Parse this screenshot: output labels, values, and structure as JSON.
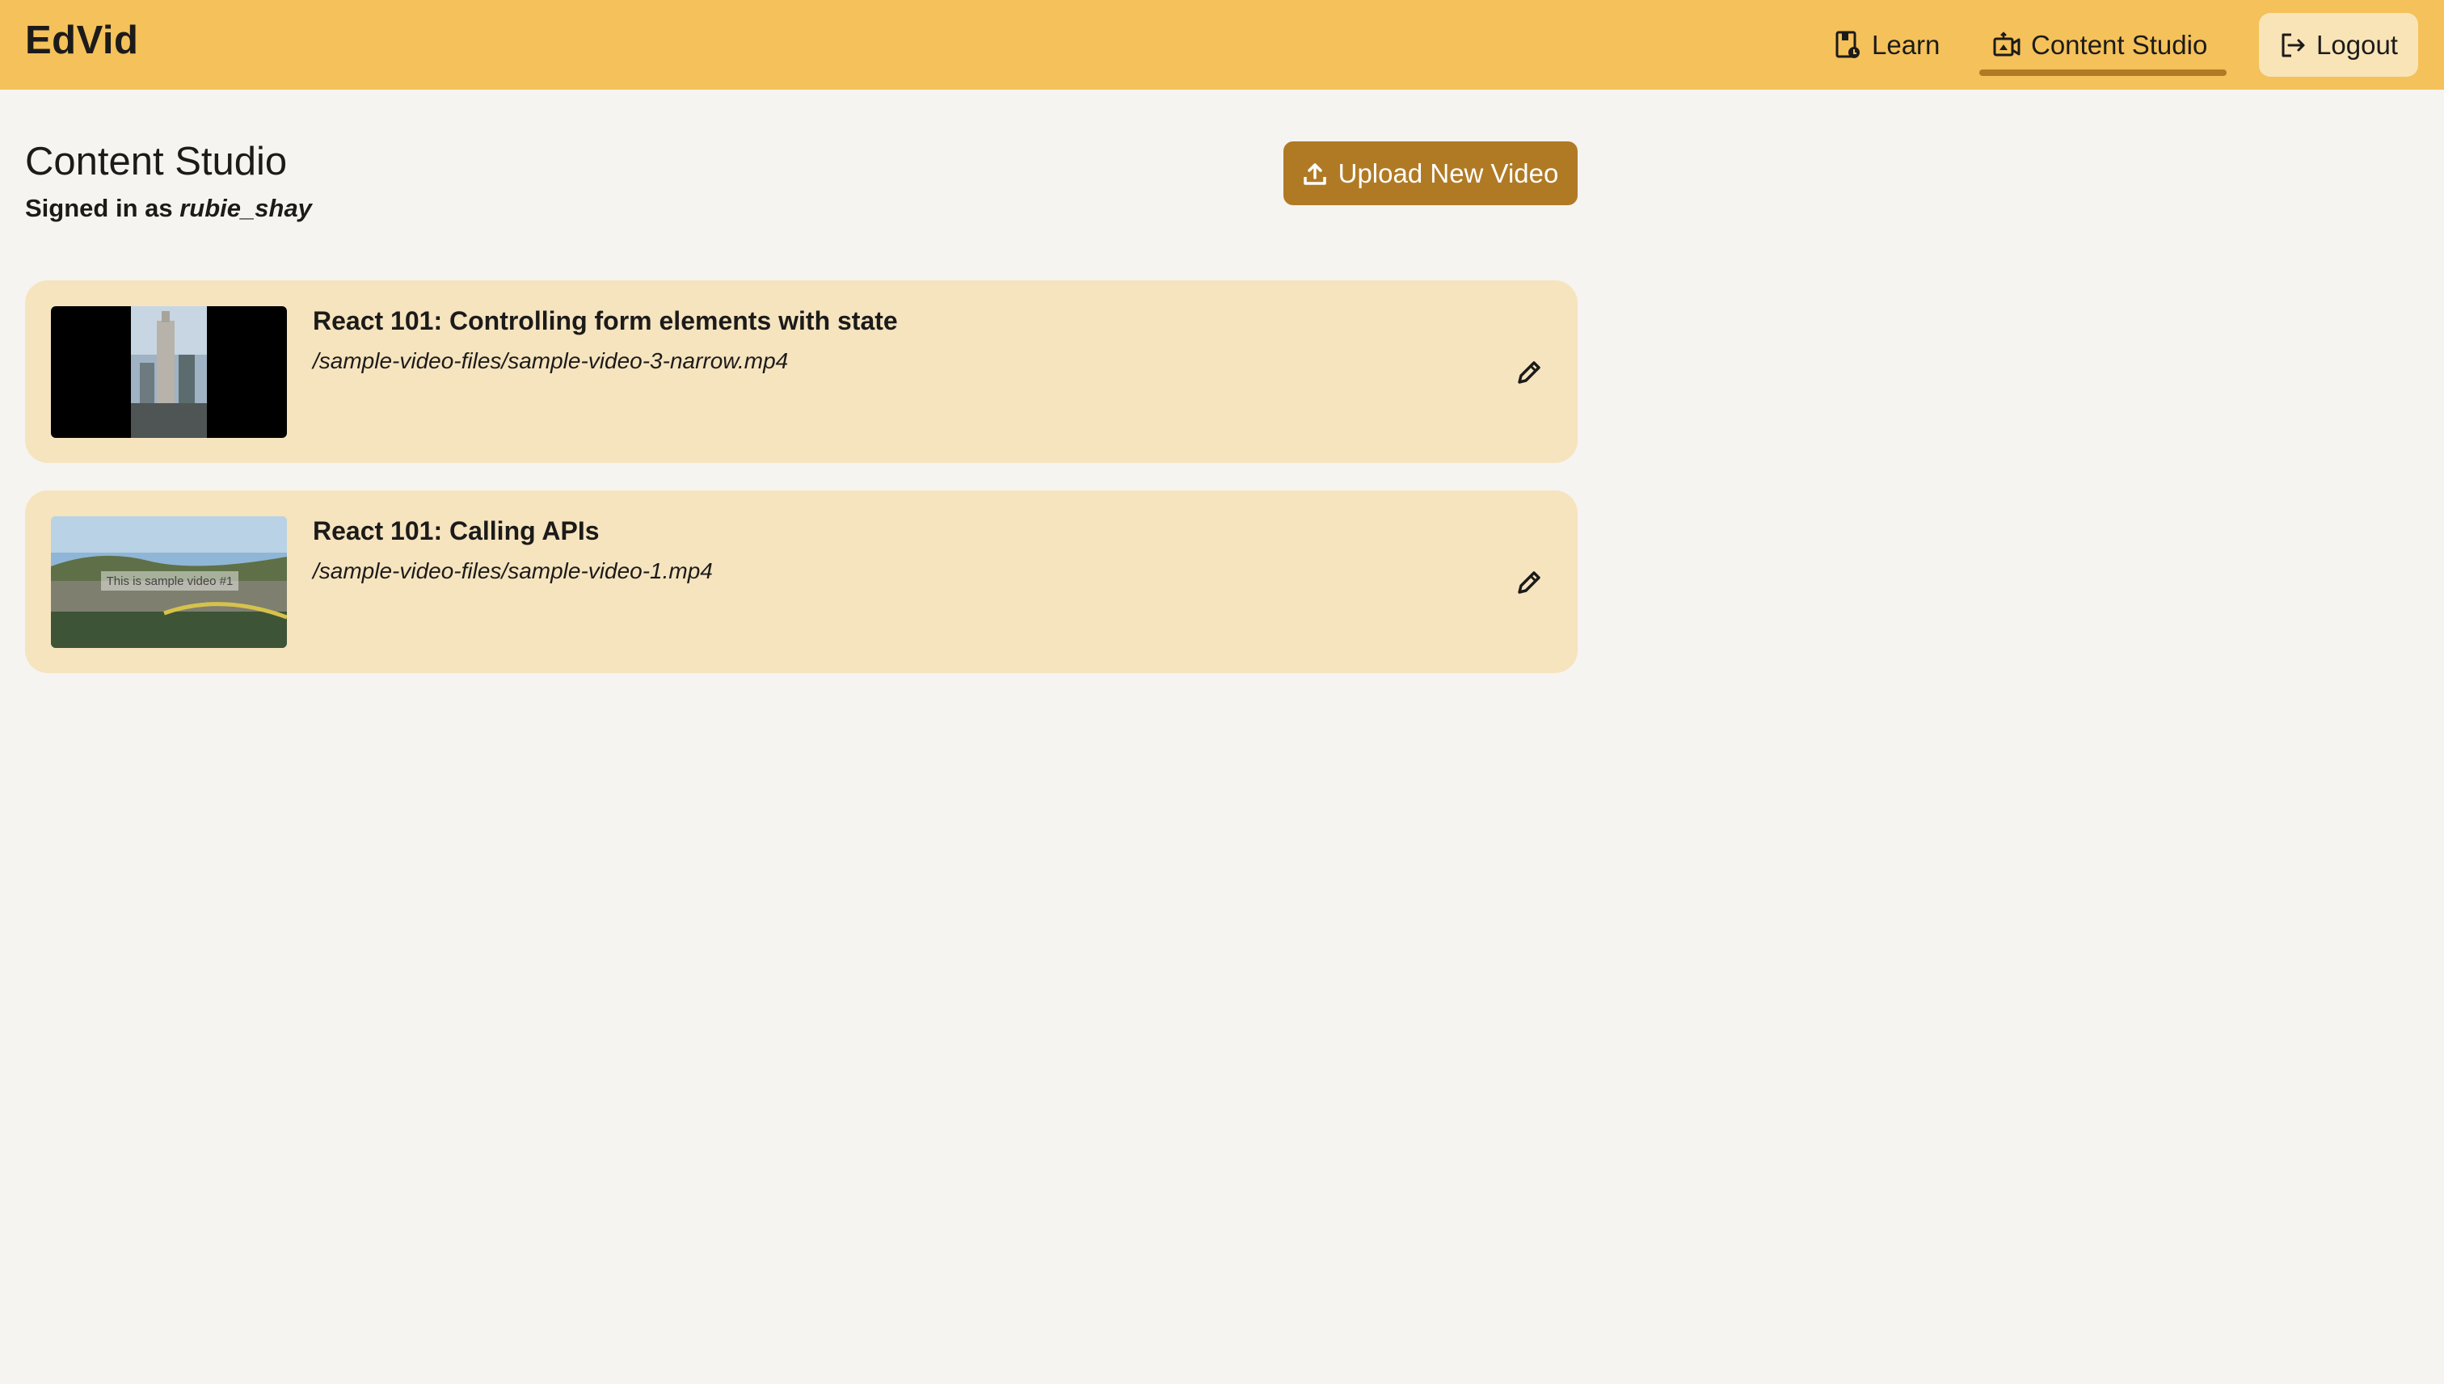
{
  "header": {
    "brand": "EdVid",
    "nav": {
      "learn_label": "Learn",
      "content_studio_label": "Content Studio",
      "logout_label": "Logout"
    }
  },
  "main": {
    "title": "Content Studio",
    "signed_in_prefix": "Signed in as",
    "username": "rubie_shay",
    "upload_label": "Upload New Video"
  },
  "videos": [
    {
      "title": "React 101: Controlling form elements with state",
      "path": "/sample-video-files/sample-video-3-narrow.mp4"
    },
    {
      "title": "React 101: Calling APIs",
      "path": "/sample-video-files/sample-video-1.mp4",
      "thumbnail_caption": "This is sample video #1"
    }
  ],
  "colors": {
    "header_bg": "#f4c15a",
    "accent": "#b07a25",
    "card_bg": "#f6e4bf",
    "page_bg": "#f6f4f0",
    "logout_bg": "#f8e4b6"
  },
  "icons": {
    "learn": "book-icon",
    "content_studio": "video-camera-icon",
    "logout": "logout-icon",
    "upload": "upload-icon",
    "edit": "pencil-icon"
  }
}
